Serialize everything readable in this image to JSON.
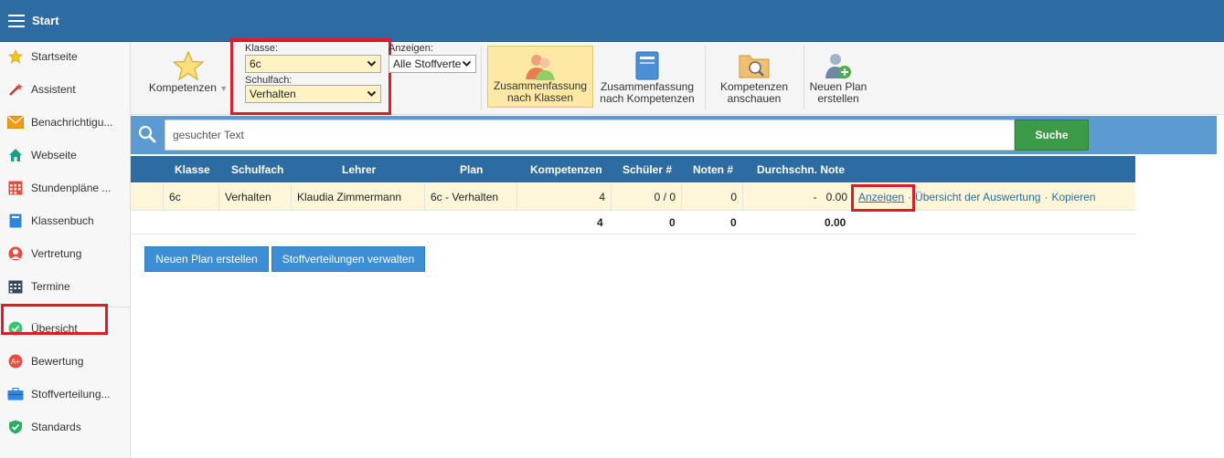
{
  "app": {
    "title": "Start"
  },
  "sidebar": {
    "items": [
      {
        "label": "Startseite",
        "icon": "star-icon"
      },
      {
        "label": "Assistent",
        "icon": "wand-icon"
      },
      {
        "label": "Benachrichtigu...",
        "icon": "envelope-icon"
      },
      {
        "label": "Webseite",
        "icon": "house-icon"
      },
      {
        "label": "Stundenpläne ...",
        "icon": "calendar-icon"
      },
      {
        "label": "Klassenbuch",
        "icon": "book-icon"
      },
      {
        "label": "Vertretung",
        "icon": "person-icon"
      },
      {
        "label": "Termine",
        "icon": "calendar-dark-icon"
      },
      {
        "label": "Übersicht",
        "icon": "check-circle-icon"
      },
      {
        "label": "Bewertung",
        "icon": "grade-icon"
      },
      {
        "label": "Stoffverteilung...",
        "icon": "briefcase-icon"
      },
      {
        "label": "Standards",
        "icon": "shield-check-icon"
      }
    ]
  },
  "toolbar": {
    "kompetenzen_label": "Kompetenzen",
    "klasse_label": "Klasse:",
    "klasse_value": "6c",
    "schulfach_label": "Schulfach:",
    "schulfach_value": "Verhalten",
    "anzeigen_label": "Anzeigen:",
    "anzeigen_value": "Alle Stoffverte",
    "btn_zusammenfassung_klassen": [
      "Zusammenfassung",
      "nach Klassen"
    ],
    "btn_zusammenfassung_kompetenzen": [
      "Zusammenfassung",
      "nach Kompetenzen"
    ],
    "btn_kompetenzen_anschauen": [
      "Kompetenzen",
      "anschauen"
    ],
    "btn_neuen_plan": [
      "Neuen Plan",
      "erstellen"
    ]
  },
  "search": {
    "placeholder": "gesuchter Text",
    "button_label": "Suche"
  },
  "table": {
    "headers": [
      "Klasse",
      "Schulfach",
      "Lehrer",
      "Plan",
      "Kompetenzen",
      "Schüler #",
      "Noten #",
      "Durchschn. Note"
    ],
    "rows": [
      {
        "klasse": "6c",
        "schulfach": "Verhalten",
        "lehrer": "Klaudia Zimmermann",
        "plan": "6c - Verhalten",
        "kompetenzen": "4",
        "schueler": "0 / 0",
        "noten": "0",
        "durchschnitt_dash": "-",
        "durchschnitt": "0.00",
        "actions": [
          "Anzeigen",
          "Übersicht der Auswertung",
          "Kopieren"
        ]
      }
    ],
    "totals": {
      "kompetenzen": "4",
      "schueler": "0",
      "noten": "0",
      "durchschnitt": "0.00"
    }
  },
  "buttons": {
    "neuen_plan": "Neuen Plan erstellen",
    "stoffverteilungen": "Stoffverteilungen verwalten"
  },
  "colors": {
    "header_blue": "#2d6ca2",
    "search_blue": "#5b9bd1",
    "search_green": "#3c9b48",
    "row_highlight": "#fdf6d8",
    "annotation_red": "#e01b24"
  }
}
